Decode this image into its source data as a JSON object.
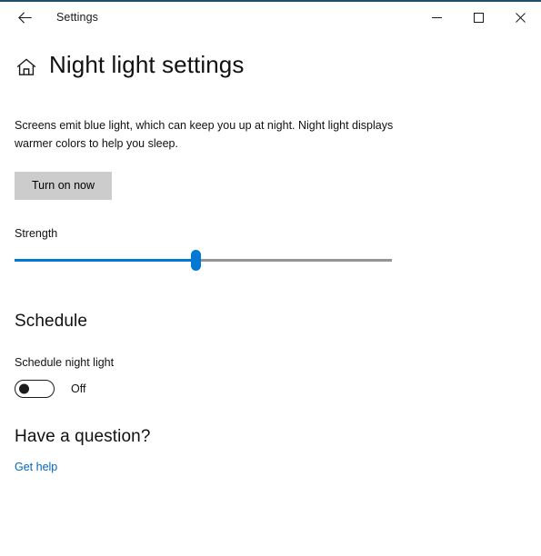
{
  "window": {
    "title": "Settings",
    "accent_color": "#204e6b",
    "back_icon": "back-arrow-icon",
    "controls": {
      "minimize_label": "Minimize",
      "maximize_label": "Maximize",
      "close_label": "Close"
    }
  },
  "page": {
    "home_icon": "home-icon",
    "title": "Night light settings",
    "description": "Screens emit blue light, which can keep you up at night. Night light displays warmer colors to help you sleep.",
    "turn_on_button_label": "Turn on now"
  },
  "strength": {
    "label": "Strength",
    "value_percent": 48,
    "fill_color": "#0078d4",
    "track_color": "#949494"
  },
  "schedule": {
    "heading": "Schedule",
    "toggle_label": "Schedule night light",
    "toggle_state": "Off"
  },
  "help": {
    "heading": "Have a question?",
    "link_label": "Get help",
    "link_color": "#0067c0"
  }
}
